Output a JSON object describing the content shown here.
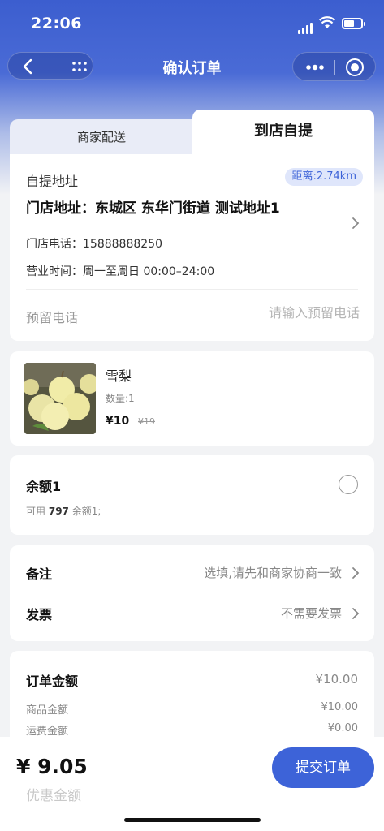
{
  "status_bar": {
    "time": "22:06"
  },
  "nav": {
    "title": "确认订单"
  },
  "tabs": [
    {
      "label": "商家配送"
    },
    {
      "label": "到店自提"
    }
  ],
  "pickup": {
    "label": "自提地址",
    "distance": "距离:2.74km",
    "address": "门店地址：东城区 东华门街道 测试地址1",
    "phone": "门店电话：15888888250",
    "hours": "营业时间：周一至周日 00:00–24:00",
    "reserve_label": "预留电话",
    "reserve_placeholder": "请输入预留电话"
  },
  "product": {
    "name": "雪梨",
    "quantity": "数量:1",
    "price": "¥10",
    "original_price": "¥19"
  },
  "balance": {
    "title": "余额1",
    "sub_prefix": "可用",
    "amount": "797",
    "sub_suffix": "余额1;"
  },
  "options": {
    "remark_label": "备注",
    "remark_value": "选填,请先和商家协商一致",
    "invoice_label": "发票",
    "invoice_value": "不需要发票"
  },
  "summary": {
    "title": "订单金额",
    "total": "¥10.00",
    "rows": [
      {
        "label": "商品金额",
        "value": "¥10.00"
      },
      {
        "label": "运费金额",
        "value": "¥0.00"
      }
    ],
    "hidden_label": "优惠金额"
  },
  "bottom": {
    "pay_amount": "¥ 9.05",
    "submit_label": "提交订单"
  },
  "colors": {
    "primary": "#3d63d8",
    "nav_bg": "#3c5ecf"
  }
}
